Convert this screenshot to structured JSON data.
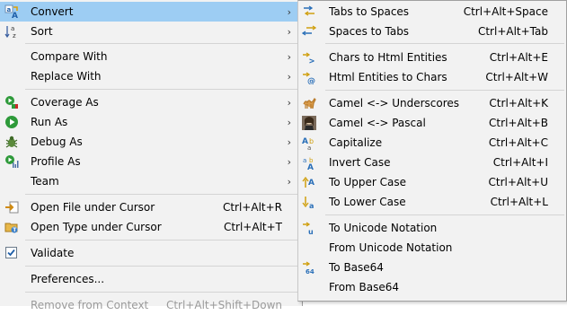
{
  "main_menu": {
    "convert": "Convert",
    "sort": "Sort",
    "compare_with": "Compare With",
    "replace_with": "Replace With",
    "coverage_as": "Coverage As",
    "run_as": "Run As",
    "debug_as": "Debug As",
    "profile_as": "Profile As",
    "team": "Team",
    "open_file": {
      "label": "Open File under Cursor",
      "accel": "Ctrl+Alt+R"
    },
    "open_type": {
      "label": "Open Type under Cursor",
      "accel": "Ctrl+Alt+T"
    },
    "validate": "Validate",
    "preferences": "Preferences...",
    "remove_context": {
      "label": "Remove from Context",
      "accel": "Ctrl+Alt+Shift+Down"
    },
    "arrow": "›"
  },
  "convert_submenu": {
    "tabs_to_spaces": {
      "label": "Tabs to Spaces",
      "accel": "Ctrl+Alt+Space"
    },
    "spaces_to_tabs": {
      "label": "Spaces to Tabs",
      "accel": "Ctrl+Alt+Tab"
    },
    "chars_to_html": {
      "label": "Chars to Html Entities",
      "accel": "Ctrl+Alt+E"
    },
    "html_to_chars": {
      "label": "Html Entities to Chars",
      "accel": "Ctrl+Alt+W"
    },
    "camel_underscores": {
      "label": "Camel <-> Underscores",
      "accel": "Ctrl+Alt+K"
    },
    "camel_pascal": {
      "label": "Camel <-> Pascal",
      "accel": "Ctrl+Alt+B"
    },
    "capitalize": {
      "label": "Capitalize",
      "accel": "Ctrl+Alt+C"
    },
    "invert_case": {
      "label": "Invert Case",
      "accel": "Ctrl+Alt+I"
    },
    "to_upper": {
      "label": "To Upper Case",
      "accel": "Ctrl+Alt+U"
    },
    "to_lower": {
      "label": "To Lower Case",
      "accel": "Ctrl+Alt+L"
    },
    "to_unicode": {
      "label": "To Unicode Notation"
    },
    "from_unicode": {
      "label": "From Unicode Notation"
    },
    "to_base64": {
      "label": "To Base64"
    },
    "from_base64": {
      "label": "From Base64"
    }
  },
  "colors": {
    "menu_bg": "#f2f2f2",
    "highlight": "#9dcdf3",
    "separator": "#d4d4d4",
    "disabled_text": "#9a9a9a"
  }
}
